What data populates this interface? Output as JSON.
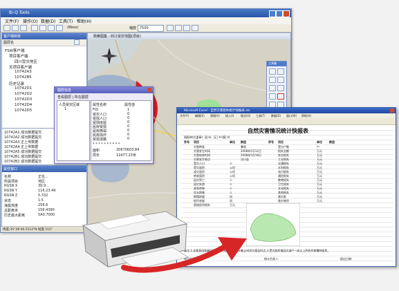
{
  "app": {
    "title": "Bi-Q Tools",
    "menu": [
      "文件(F)",
      "操作(O)",
      "数据(D)",
      "工具(T)",
      "帮助(H)"
    ],
    "toolbar": {
      "zoom_label": "缩放",
      "zoom_value": "7500",
      "scale_text": "(Bbox)"
    },
    "left_panel": {
      "title": "客户端树状",
      "subtitle": "图层名",
      "tree": [
        "FSW客户端",
        "项目客户端",
        "四川受灾地区",
        "无项目客户端",
        "10742A3",
        "10742B5",
        "历史记录",
        "10742D1",
        "10742D2",
        "10742D3",
        "10742D4",
        "10742D5"
      ]
    },
    "log_lines": [
      "10742A1  成功数据提交",
      "10742A2  成功数据提交",
      "10742A3  正上传数据",
      "10742A4  正上传数据",
      "10742A5  成功数据提交",
      "10742B1  成功数据提交",
      "10742B2  成功数据提交"
    ],
    "props_panel": {
      "title": "属性窗口",
      "rows": [
        [
          "名称",
          "正在..."
        ],
        [
          "所属项目",
          "地区"
        ],
        [
          "RGSN X",
          "39.9..."
        ],
        [
          "RGSN Y",
          "116.23.49"
        ],
        [
          "RGSN Z",
          "5.332"
        ],
        [
          "状态",
          "1.5"
        ],
        [
          "海拔高度",
          "256.6"
        ],
        [
          "总距离米",
          "156.4390"
        ],
        [
          "历史最大距离",
          "5A0.7000"
        ]
      ],
      "status": "纬度:35°36'46.5512\"N  经度:115°"
    },
    "map_window": {
      "title": "勘察图集 - 四江受灾地图(项目)"
    },
    "popup": {
      "title": "图层信息",
      "header": "查看图层 | 所在图层",
      "layer_name": "人员受灾区域",
      "sublayer": "1",
      "columns": [
        "属性名称",
        "属性值"
      ],
      "rows": [
        [
          "FID",
          "1"
        ],
        [
          "受灾人口",
          "0"
        ],
        [
          "受损人口",
          "0"
        ],
        [
          "受损房屋",
          "0"
        ],
        [
          "民房受损",
          "0"
        ],
        [
          "民房倒塌",
          "0"
        ],
        [
          "民房损坏",
          "0"
        ],
        [
          "受损道路",
          "0"
        ]
      ],
      "stars": "* * * * * * * * * *",
      "area_label": "面积",
      "area_value": "20670603.84",
      "perim_label": "周长",
      "perim_value": "12477.23米"
    },
    "map_tools": {
      "title": "工具箱"
    },
    "spreadsheet": {
      "title": "Microsoft Excel - 自然灾害损失统计快报表.xls",
      "menu": [
        "文件(F)",
        "编辑(E)",
        "视图(V)",
        "插入(I)",
        "格式(O)",
        "工具(T)",
        "数据(D)",
        "窗口(W)",
        "帮助(H)"
      ],
      "sheet_title": "自然灾害情况统计快报表",
      "meta": "填报单位(盖章):    县(市、区)      乡(镇)      村     ",
      "col_headers": [
        "序号",
        "项目",
        "单位",
        "数值",
        "序号",
        "项目",
        "单位",
        "数值"
      ],
      "left_items": [
        "灾害种类",
        "灾害发生时间",
        "灾害结束时间",
        "灾害发生地点",
        "受灾人口",
        "受灾面积",
        "成灾面积",
        "绝收面积",
        "因灾死亡",
        "因灾失踪",
        "紧急转移",
        "饮水困难",
        "倒塌房屋",
        "损坏房屋",
        "直接经济损失"
      ],
      "left_units": [
        "",
        "",
        "",
        "",
        "人",
        "公顷",
        "公顷",
        "公顷",
        "人",
        "人",
        "人",
        "人",
        "间",
        "间",
        "万元"
      ],
      "left_vals": [
        "暴雨",
        "2008年5月12日",
        "2008年5月18日",
        "汶川县",
        "",
        "",
        "",
        "",
        "",
        "",
        "",
        "",
        "",
        "",
        ""
      ],
      "right_items": [
        "受灾户数",
        "损失总额",
        "农业损失",
        "工业损失",
        "交通损失",
        "水利损失",
        "电力损失",
        "通信损失",
        "教育损失",
        "卫生损失",
        "文化损失",
        "其他损失",
        "救灾款",
        "救灾物资",
        "备注"
      ],
      "right_units": [
        "户",
        "万元",
        "万元",
        "万元",
        "万元",
        "万元",
        "万元",
        "万元",
        "万元",
        "万元",
        "万元",
        "万元",
        "万元",
        "万元",
        ""
      ],
      "footer": "备注:1.本报表由各级民政部门负责填报,2.统计截止时间为报告时点,3.受灾面积指因灾减产一成以上的农作物播种面积。",
      "signature": "单位负责人:",
      "contact": "统计负责人:",
      "date": "报出日期:"
    },
    "device": {
      "name": "激光打印机"
    }
  }
}
